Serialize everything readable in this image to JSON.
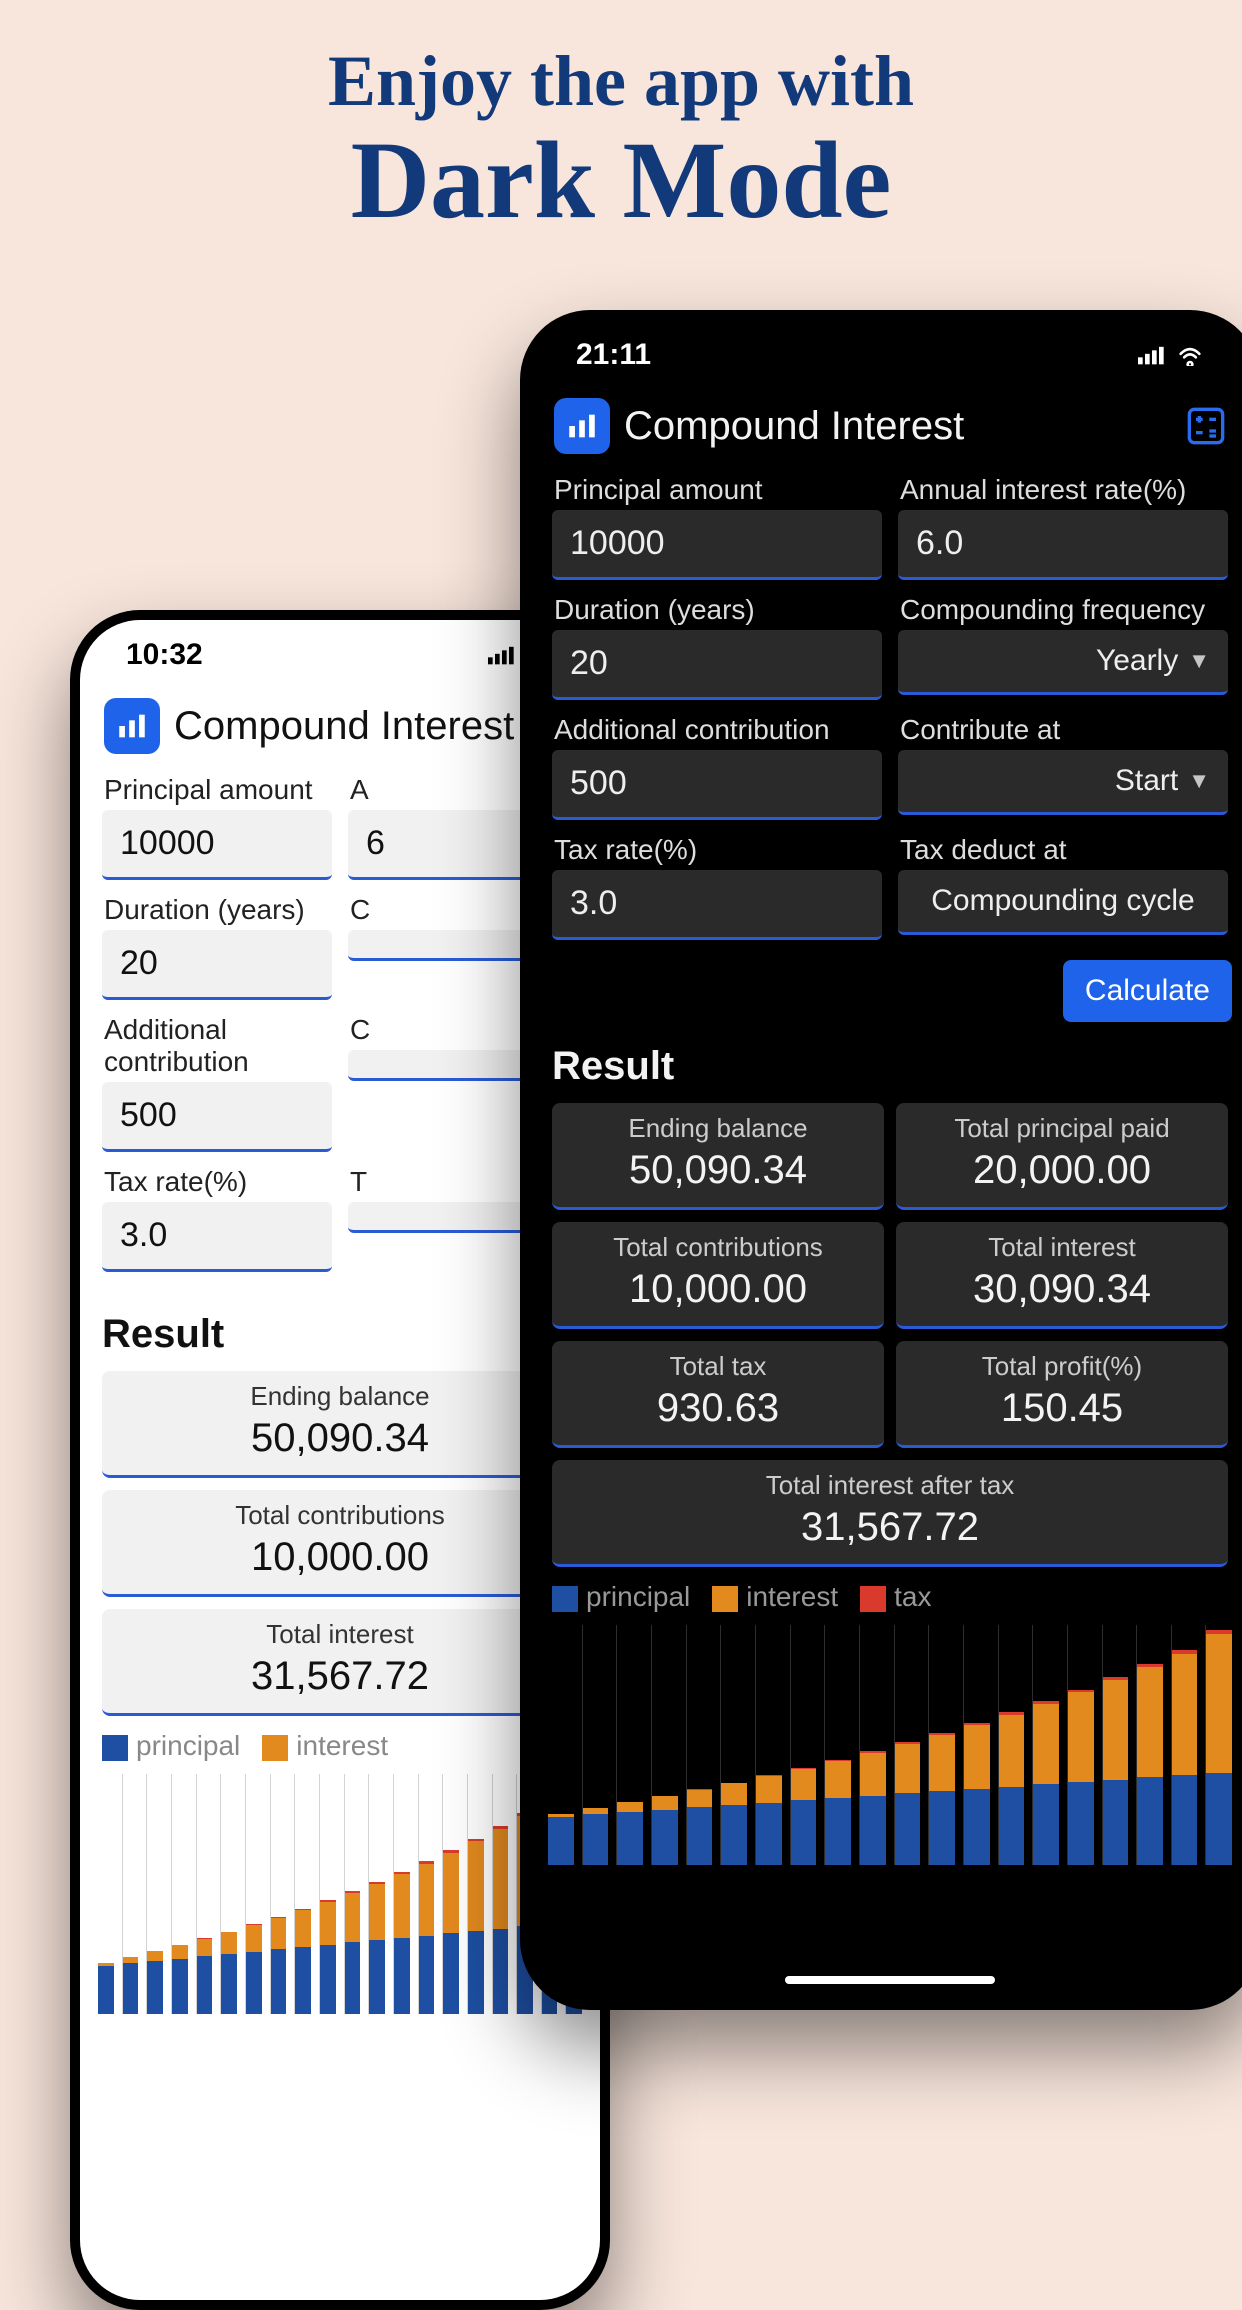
{
  "marketing": {
    "line1": "Enjoy the app with",
    "line2": "Dark Mode"
  },
  "status": {
    "time_light": "10:32",
    "time_dark": "21:11"
  },
  "app": {
    "title": "Compound Interest"
  },
  "fields": {
    "principal_label": "Principal amount",
    "principal_value": "10000",
    "rate_label": "Annual interest rate(%)",
    "rate_value": "6.0",
    "duration_label": "Duration (years)",
    "duration_value": "20",
    "freq_label": "Compounding frequency",
    "freq_value": "Yearly",
    "contrib_label": "Additional contribution",
    "contrib_value": "500",
    "contrib_at_label": "Contribute at",
    "contrib_at_value": "Start",
    "tax_label": "Tax rate(%)",
    "tax_value": "3.0",
    "tax_at_label": "Tax deduct at",
    "tax_at_value": "Compounding cycle"
  },
  "actions": {
    "calculate": "Calculate"
  },
  "result": {
    "title": "Result",
    "ending_label": "Ending balance",
    "ending_value": "50,090.34",
    "principal_label": "Total principal paid",
    "principal_value": "20,000.00",
    "contrib_label": "Total contributions",
    "contrib_value": "10,000.00",
    "interest_label": "Total interest",
    "interest_value_dark": "30,090.34",
    "interest_value_light": "31,567.72",
    "tax_label": "Total tax",
    "tax_value": "930.63",
    "profit_label": "Total profit(%)",
    "profit_value": "150.45",
    "after_tax_label": "Total interest after tax",
    "after_tax_value": "31,567.72"
  },
  "legend": {
    "principal": "principal",
    "interest": "interest",
    "tax": "tax"
  },
  "chart_data": {
    "type": "bar",
    "categories": [
      "1",
      "2",
      "3",
      "4",
      "5",
      "6",
      "7",
      "8",
      "9",
      "10",
      "11",
      "12",
      "13",
      "14",
      "15",
      "16",
      "17",
      "18",
      "19",
      "20"
    ],
    "series": [
      {
        "name": "principal",
        "values": [
          10500,
          11000,
          11500,
          12000,
          12500,
          13000,
          13500,
          14000,
          14500,
          15000,
          15500,
          16000,
          16500,
          17000,
          17500,
          18000,
          18500,
          19000,
          19500,
          20000
        ]
      },
      {
        "name": "interest",
        "values": [
          630,
          1318,
          2067,
          2881,
          3764,
          4720,
          5754,
          6870,
          8074,
          9370,
          10765,
          12264,
          13874,
          15601,
          17452,
          19434,
          21556,
          23825,
          26250,
          30090
        ]
      },
      {
        "name": "tax",
        "values": [
          19,
          40,
          62,
          86,
          113,
          142,
          173,
          206,
          242,
          281,
          323,
          368,
          416,
          468,
          524,
          583,
          647,
          715,
          788,
          931
        ]
      }
    ],
    "ylim": [
      0,
      52000
    ],
    "legend_position": "top"
  }
}
